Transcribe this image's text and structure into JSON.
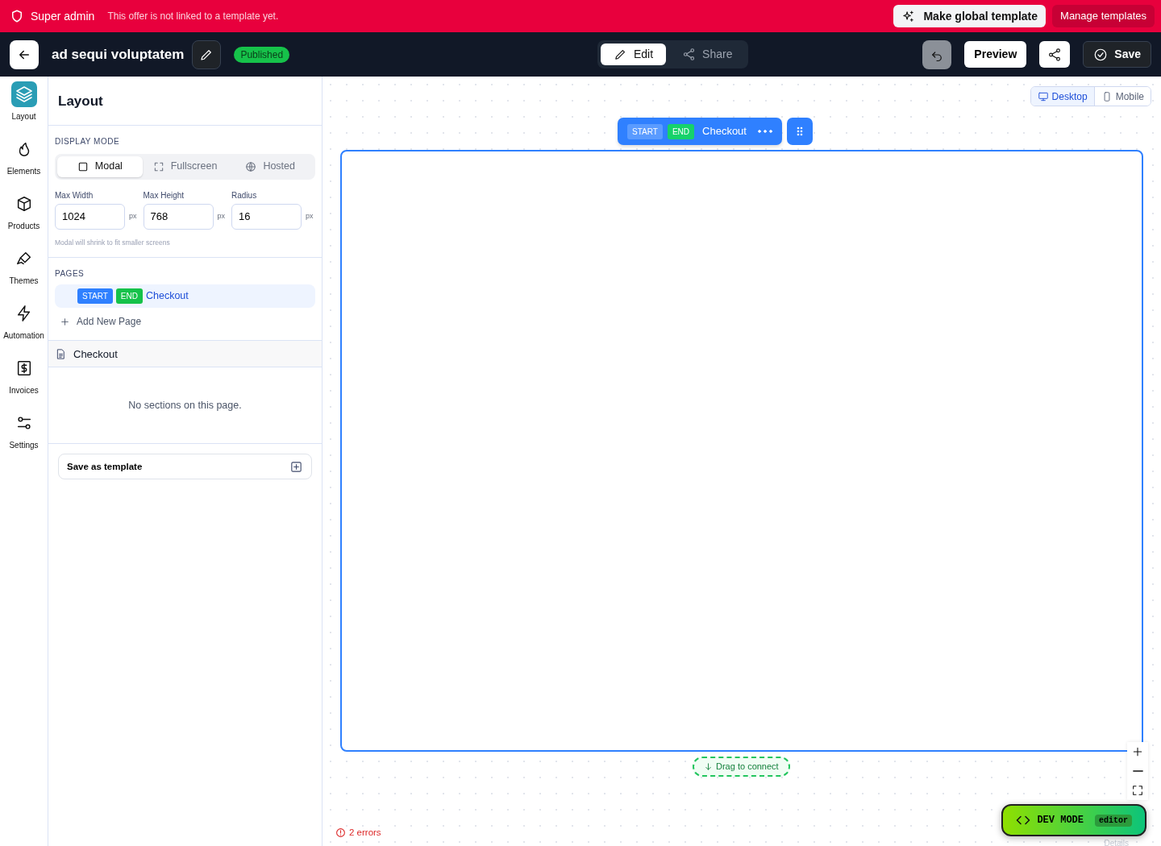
{
  "banner": {
    "role": "Super admin",
    "message": "This offer is not linked to a template yet.",
    "buttons": [
      {
        "label": "Make global template",
        "kind": "light"
      },
      {
        "label": "Manage templates",
        "kind": "dark"
      }
    ]
  },
  "header": {
    "title": "ad sequi voluptatem",
    "status": "Published",
    "mode_tabs": [
      {
        "label": "Edit",
        "selected": true
      },
      {
        "label": "Share",
        "selected": false
      }
    ],
    "undo_disabled": true,
    "preview": "Preview",
    "save": "Save"
  },
  "rail": [
    {
      "label": "Layout",
      "selected": true
    },
    {
      "label": "Elements",
      "selected": false
    },
    {
      "label": "Products",
      "selected": false
    },
    {
      "label": "Themes",
      "selected": false
    },
    {
      "label": "Automation",
      "selected": false
    },
    {
      "label": "Invoices",
      "selected": false
    },
    {
      "label": "Settings",
      "selected": false
    }
  ],
  "panel": {
    "title": "Layout",
    "display_mode": {
      "heading": "DISPLAY MODE",
      "options": [
        {
          "label": "Modal",
          "selected": true
        },
        {
          "label": "Fullscreen",
          "selected": false
        },
        {
          "label": "Hosted",
          "selected": false
        }
      ]
    },
    "fields": [
      {
        "label": "Max Width",
        "value": "1024",
        "unit": "px"
      },
      {
        "label": "Max Height",
        "value": "768",
        "unit": "px"
      },
      {
        "label": "Radius",
        "value": "16",
        "unit": "px"
      }
    ],
    "hint": "Modal will shrink to fit smaller screens",
    "pages": {
      "heading": "PAGES",
      "items": [
        {
          "start": "START",
          "end": "END",
          "name": "Checkout",
          "selected": true
        }
      ],
      "add": "Add New Page"
    },
    "section_page": "Checkout",
    "empty": "No sections on this page.",
    "save_template": "Save as template"
  },
  "canvas": {
    "devices": [
      {
        "label": "Desktop",
        "selected": true
      },
      {
        "label": "Mobile",
        "selected": false
      }
    ],
    "page_node": {
      "start": "START",
      "end": "END",
      "name": "Checkout"
    },
    "connector": "Drag to connect",
    "dev_mode": {
      "label": "DEV MODE",
      "tag": "editor"
    },
    "details": "Details",
    "errors": "2 errors"
  }
}
